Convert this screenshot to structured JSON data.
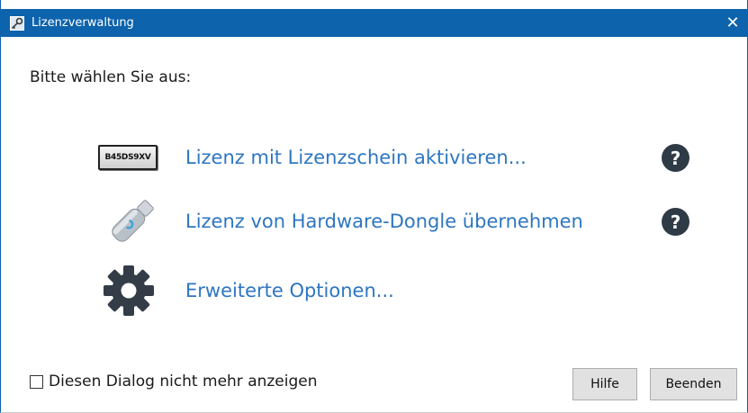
{
  "window": {
    "title": "Lizenzverwaltung",
    "close_glyph": "✕",
    "title_icon": "key-icon",
    "titlebar_color": "#0d63ac"
  },
  "prompt": "Bitte wählen Sie aus:",
  "options": [
    {
      "label": "Lizenz mit Lizenzschein aktivieren...",
      "icon": "license-certificate-icon",
      "icon_text": "B45DS9XV",
      "help": "?"
    },
    {
      "label": "Lizenz von Hardware-Dongle übernehmen",
      "icon": "usb-dongle-icon",
      "help": "?"
    },
    {
      "label": "Erweiterte Optionen...",
      "icon": "gear-icon"
    }
  ],
  "footer": {
    "checkbox_label": "Diesen Dialog nicht mehr anzeigen",
    "checkbox_checked": false,
    "help_button": "Hilfe",
    "exit_button": "Beenden"
  },
  "colors": {
    "link": "#2e76c2",
    "help_circle": "#2f3a47"
  }
}
